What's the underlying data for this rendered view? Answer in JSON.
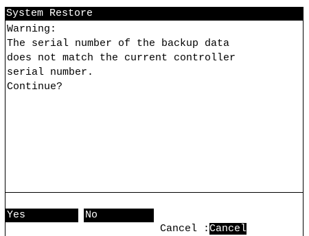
{
  "window": {
    "title": "System Restore"
  },
  "message": {
    "lines": [
      "Warning:",
      "The serial number of the backup data",
      "does not match the current controller",
      "serial number.",
      "Continue?"
    ]
  },
  "softkeys": {
    "yes_label": "Yes",
    "no_label": "No"
  },
  "cancel": {
    "prefix": "Cancel :",
    "button_label": "Cancel"
  },
  "colors": {
    "background": "#ffffff",
    "foreground": "#000000",
    "highlight": "#000000"
  }
}
